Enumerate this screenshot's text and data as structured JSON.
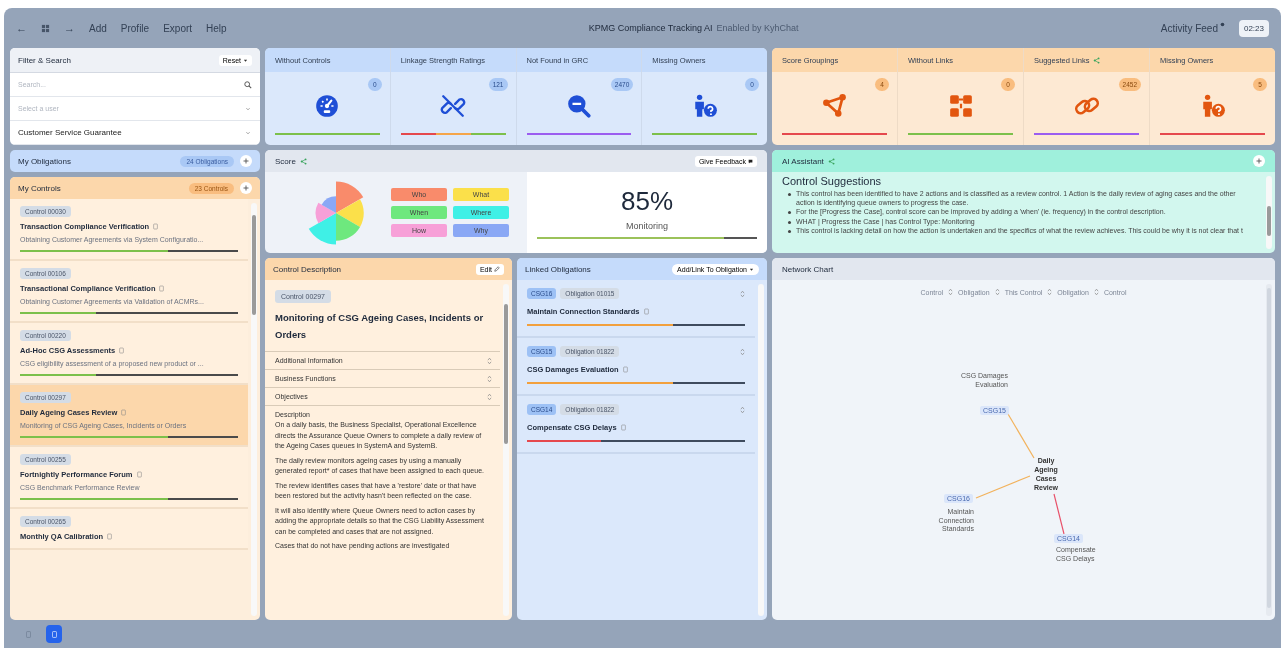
{
  "topbar": {
    "back": "←",
    "forward": "→",
    "menu": [
      "Add",
      "Profile",
      "Export",
      "Help"
    ],
    "title": "KPMG Compliance Tracking AI",
    "subtitle": "Enabled by KyhChat",
    "activity_feed": "Activity Feed",
    "time": "02:23"
  },
  "filter": {
    "title": "Filter & Search",
    "reset": "Reset",
    "search": {
      "placeholder": "Search..."
    },
    "user": {
      "placeholder": "Select a user"
    },
    "program": {
      "value": "Customer Service Guarantee"
    }
  },
  "blue_stats": [
    {
      "label": "Without Controls",
      "count": "0",
      "segments": [
        {
          "color": "#7cc04b"
        }
      ]
    },
    {
      "label": "Linkage Strength Ratings",
      "count": "121",
      "segments": [
        {
          "color": "#e5484d"
        },
        {
          "color": "#f5a54a"
        },
        {
          "color": "#7cc04b"
        }
      ]
    },
    {
      "label": "Not Found in GRC",
      "count": "2470",
      "segments": [
        {
          "color": "#9b5cf0"
        }
      ]
    },
    {
      "label": "Missing Owners",
      "count": "0",
      "segments": [
        {
          "color": "#7cc04b"
        }
      ]
    }
  ],
  "orange_stats": [
    {
      "label": "Score Groupings",
      "count": "4",
      "shared": false,
      "segments": [
        {
          "color": "#e5484d"
        }
      ]
    },
    {
      "label": "Without Links",
      "count": "0",
      "shared": false,
      "segments": [
        {
          "color": "#7cc04b"
        }
      ]
    },
    {
      "label": "Suggested Links",
      "count": "2452",
      "shared": true,
      "segments": [
        {
          "color": "#9b5cf0"
        }
      ]
    },
    {
      "label": "Missing Owners",
      "count": "5",
      "shared": false,
      "segments": [
        {
          "color": "#e5484d"
        }
      ]
    }
  ],
  "obligations": {
    "title": "My Obligations",
    "count": "24 Obligations"
  },
  "controls": {
    "title": "My Controls",
    "count": "23 Controls",
    "items": [
      {
        "id": "Control 00030",
        "title": "Transaction Compliance Verification",
        "subtitle": "Obtaining Customer Agreements via System Configuratio...",
        "level": 0.68,
        "selected": false
      },
      {
        "id": "Control 00106",
        "title": "Transactional Compliance Verification",
        "subtitle": "Obtaining Customer Agreements via Validation of ACMRs...",
        "level": 0.35,
        "selected": false
      },
      {
        "id": "Control 00220",
        "title": "Ad-Hoc CSG Assessments",
        "subtitle": "CSG eligibility assessment of a proposed new product or ...",
        "level": 0.35,
        "selected": false
      },
      {
        "id": "Control 00297",
        "title": "Daily Ageing Cases Review",
        "subtitle": "Monitoring of CSG Ageing Cases, Incidents or Orders",
        "level": 0.68,
        "selected": true
      },
      {
        "id": "Control 00255",
        "title": "Fortnightly Performance Forum",
        "subtitle": "CSG Benchmark Performance Review",
        "level": 0.68,
        "selected": false
      },
      {
        "id": "Control 00265",
        "title": "Monthly QA Calibration",
        "selected": false
      }
    ]
  },
  "score": {
    "title": "Score",
    "feedback": "Give Feedback",
    "legend": [
      {
        "label": "Who",
        "color": "#f98b6b"
      },
      {
        "label": "What",
        "color": "#fbe04a"
      },
      {
        "label": "When",
        "color": "#6ee87e"
      },
      {
        "label": "Where",
        "color": "#3ff0e6"
      },
      {
        "label": "How",
        "color": "#f7a0d8"
      },
      {
        "label": "Why",
        "color": "#8aa8f5"
      }
    ],
    "value": "85%",
    "category": "Monitoring",
    "level": 0.85
  },
  "assistant": {
    "title": "AI Assistant",
    "heading": "Control Suggestions",
    "bullets": [
      "This control has been identified to have 2 actions and is classified as a review control. 1 Action is the daily review of aging cases and the other action is identifying queue owners to progress the case.",
      "For the [Progress the Case], control score can be improved by adding a 'when' (ie. frequency) in the control description.",
      "WHAT | Progress the Case | has Control Type: Monitoring",
      "This control is lacking detail on how the action is undertaken and the specifics of what the review achieves. This could be why it is not clear that t"
    ]
  },
  "description": {
    "title": "Control Description",
    "edit": "Edit",
    "id": "Control 00297",
    "name": "Monitoring of CSG Ageing Cases, Incidents or Orders",
    "sections": [
      "Additional Information",
      "Business Functions",
      "Objectives"
    ],
    "label": "Description",
    "paragraphs": [
      "On a daily basis, the Business Specialist, Operational Excellence directs the Assurance Queue Owners to complete a daily review of the Ageing Cases queues in SystemA and SystemB.",
      "The daily review monitors ageing cases by using a manually generated report* of cases that have been assigned to each queue.",
      "The review identifies cases that have a 'restore' date or that have been restored but the activity hasn't been reflected on the case.",
      "It will also identify where Queue Owners need to action cases by adding the appropriate details so that the CSG Liability Assessment can be completed and cases that are not assigned.",
      "Cases that do not have pending actions are investigated"
    ]
  },
  "linked": {
    "title": "Linked Obligations",
    "add": "Add/Link To Obligation",
    "items": [
      {
        "code": "CSG16",
        "id": "Obligation 01015",
        "title": "Maintain Connection Standards",
        "level": 0.67,
        "color": "#f2a03d"
      },
      {
        "code": "CSG15",
        "id": "Obligation 01822",
        "title": "CSG Damages Evaluation",
        "level": 0.67,
        "color": "#f2a03d"
      },
      {
        "code": "CSG14",
        "id": "Obligation 01822",
        "title": "Compensate CSG Delays",
        "level": 0.34,
        "color": "#e5484d"
      }
    ]
  },
  "network": {
    "title": "Network Chart",
    "legend": [
      "Control",
      "Obligation",
      "This Control",
      "Obligation",
      "Control"
    ],
    "center": "Daily Ageing Cases Review",
    "nodes": [
      {
        "code": "CSG15",
        "label": "CSG Damages Evaluation",
        "color": "#f2b25c"
      },
      {
        "code": "CSG16",
        "label": "Maintain Connection Standards",
        "color": "#f2b25c"
      },
      {
        "code": "CSG14",
        "label": "Compensate CSG Delays",
        "color": "#e8506a"
      }
    ]
  },
  "views": [
    {
      "selected": false
    },
    {
      "selected": true
    }
  ]
}
